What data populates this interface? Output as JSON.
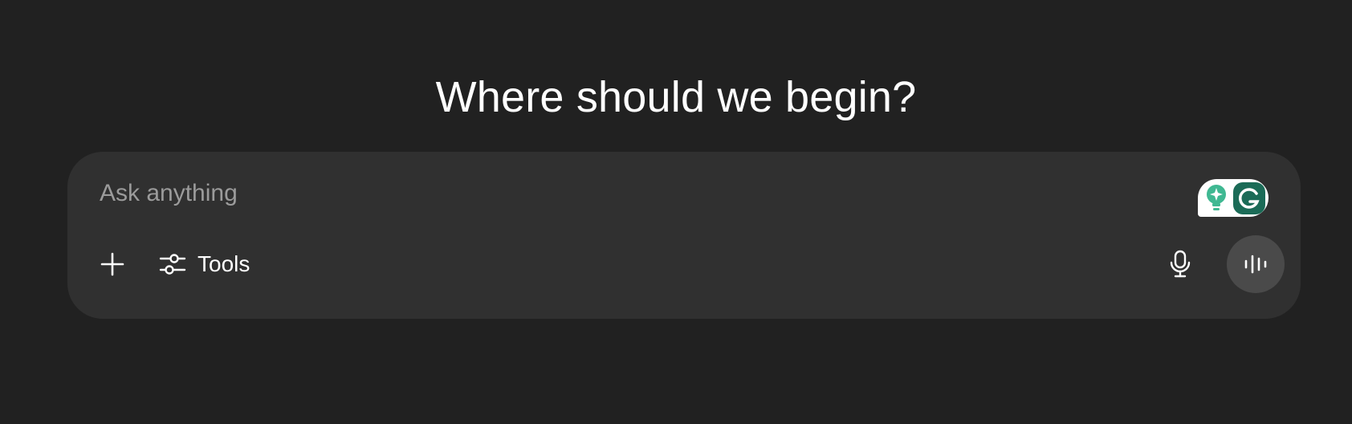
{
  "heading": {
    "text": "Where should we begin?"
  },
  "composer": {
    "placeholder": "Ask anything",
    "value": "",
    "grammarly": {
      "bulb_icon": "lightbulb-sparkle-icon",
      "logo_icon": "grammarly-g-icon",
      "accent_color": "#15c39a",
      "logo_color": "#1b6b57"
    },
    "toolbar": {
      "add_icon": "plus-icon",
      "tools_label": "Tools",
      "tools_icon": "sliders-icon",
      "mic_icon": "microphone-icon",
      "voice_icon": "voice-waveform-icon"
    }
  },
  "colors": {
    "background": "#212121",
    "composer_background": "#303030",
    "voice_button_background": "#4a4a4a",
    "text": "#ffffff",
    "placeholder": "#9b9b9b"
  }
}
